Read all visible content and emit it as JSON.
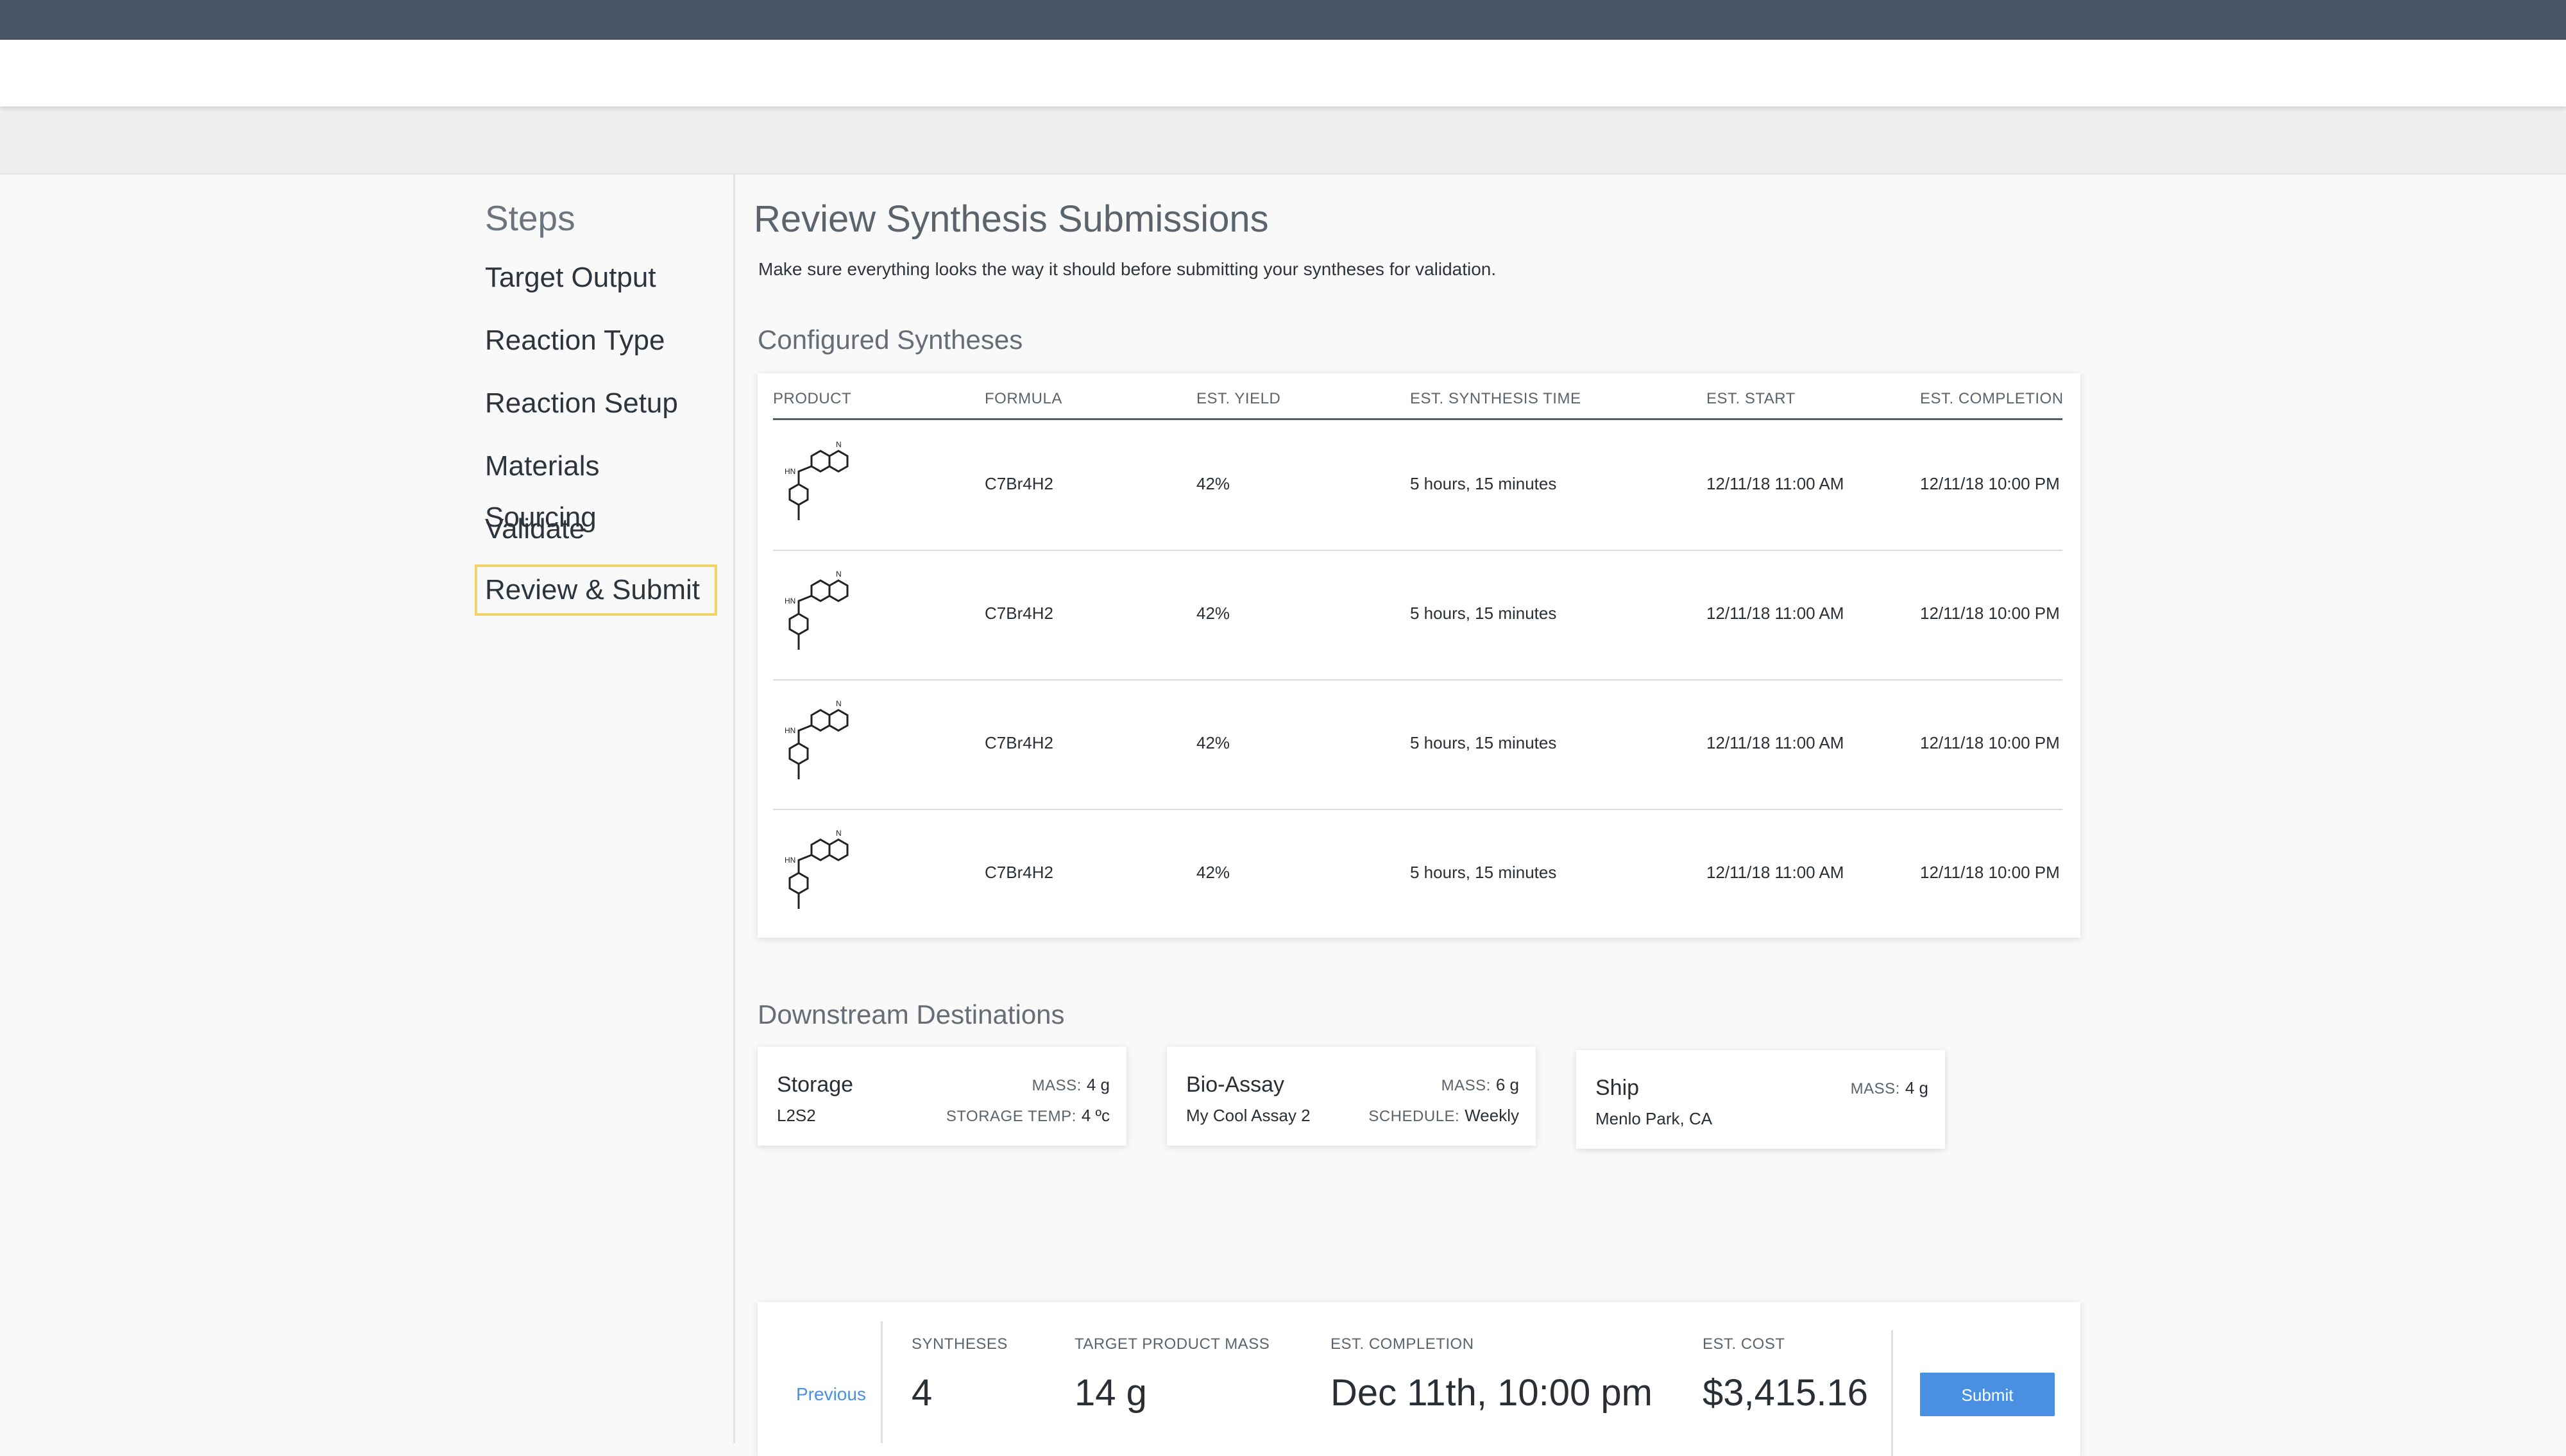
{
  "steps": {
    "title": "Steps",
    "items": [
      "Target Output",
      "Reaction Type",
      "Reaction Setup",
      "Materials Sourcing",
      "Validate",
      "Review & Submit"
    ],
    "active": "Review & Submit"
  },
  "review": {
    "title": "Review Synthesis Submissions",
    "description": "Make sure everything looks the way it should before submitting your syntheses for validation."
  },
  "configured": {
    "title": "Configured Syntheses",
    "columns": [
      "PRODUCT",
      "FORMULA",
      "EST. YIELD",
      "EST. SYNTHESIS TIME",
      "EST. START",
      "EST. COMPLETION"
    ],
    "rows": [
      {
        "formula": "C7Br4H2",
        "yield": "42%",
        "time": "5 hours, 15 minutes",
        "start": "12/11/18 11:00 AM",
        "completion": "12/11/18 10:00 PM",
        "mol_labels": [
          "HN",
          "N"
        ]
      },
      {
        "formula": "C7Br4H2",
        "yield": "42%",
        "time": "5 hours, 15 minutes",
        "start": "12/11/18 11:00 AM",
        "completion": "12/11/18 10:00 PM",
        "mol_labels": [
          "HN",
          "N"
        ]
      },
      {
        "formula": "C7Br4H2",
        "yield": "42%",
        "time": "5 hours, 15 minutes",
        "start": "12/11/18 11:00 AM",
        "completion": "12/11/18 10:00 PM",
        "mol_labels": [
          "HN",
          "N"
        ]
      },
      {
        "formula": "C7Br4H2",
        "yield": "42%",
        "time": "5 hours, 15 minutes",
        "start": "12/11/18 11:00 AM",
        "completion": "12/11/18 10:00 PM",
        "mol_labels": [
          "HN",
          "N"
        ]
      }
    ]
  },
  "destinations": {
    "title": "Downstream Destinations",
    "cards": [
      {
        "name": "Storage",
        "sub": "L2S2",
        "kv1_key": "MASS:",
        "kv1_val": "4 g",
        "kv2_key": "STORAGE TEMP:",
        "kv2_val": "4 ºc"
      },
      {
        "name": "Bio-Assay",
        "sub": "My Cool Assay 2",
        "kv1_key": "MASS:",
        "kv1_val": "6 g",
        "kv2_key": "SCHEDULE:",
        "kv2_val": "Weekly"
      },
      {
        "name": "Ship",
        "sub": "Menlo Park, CA",
        "kv1_key": "MASS:",
        "kv1_val": "4 g"
      }
    ]
  },
  "footer": {
    "previous": "Previous",
    "syntheses_label": "SYNTHESES",
    "syntheses_value": "4",
    "mass_label": "TARGET PRODUCT MASS",
    "mass_value": "14 g",
    "completion_label": "EST. COMPLETION",
    "completion_value": "Dec 11th, 10:00 pm",
    "cost_label": "EST. COST",
    "cost_value": "$3,415.16",
    "submit": "Submit"
  },
  "colors": {
    "topbar": "#4a5565",
    "accent": "#4a90e2",
    "active_step_border": "#f3d36a"
  }
}
